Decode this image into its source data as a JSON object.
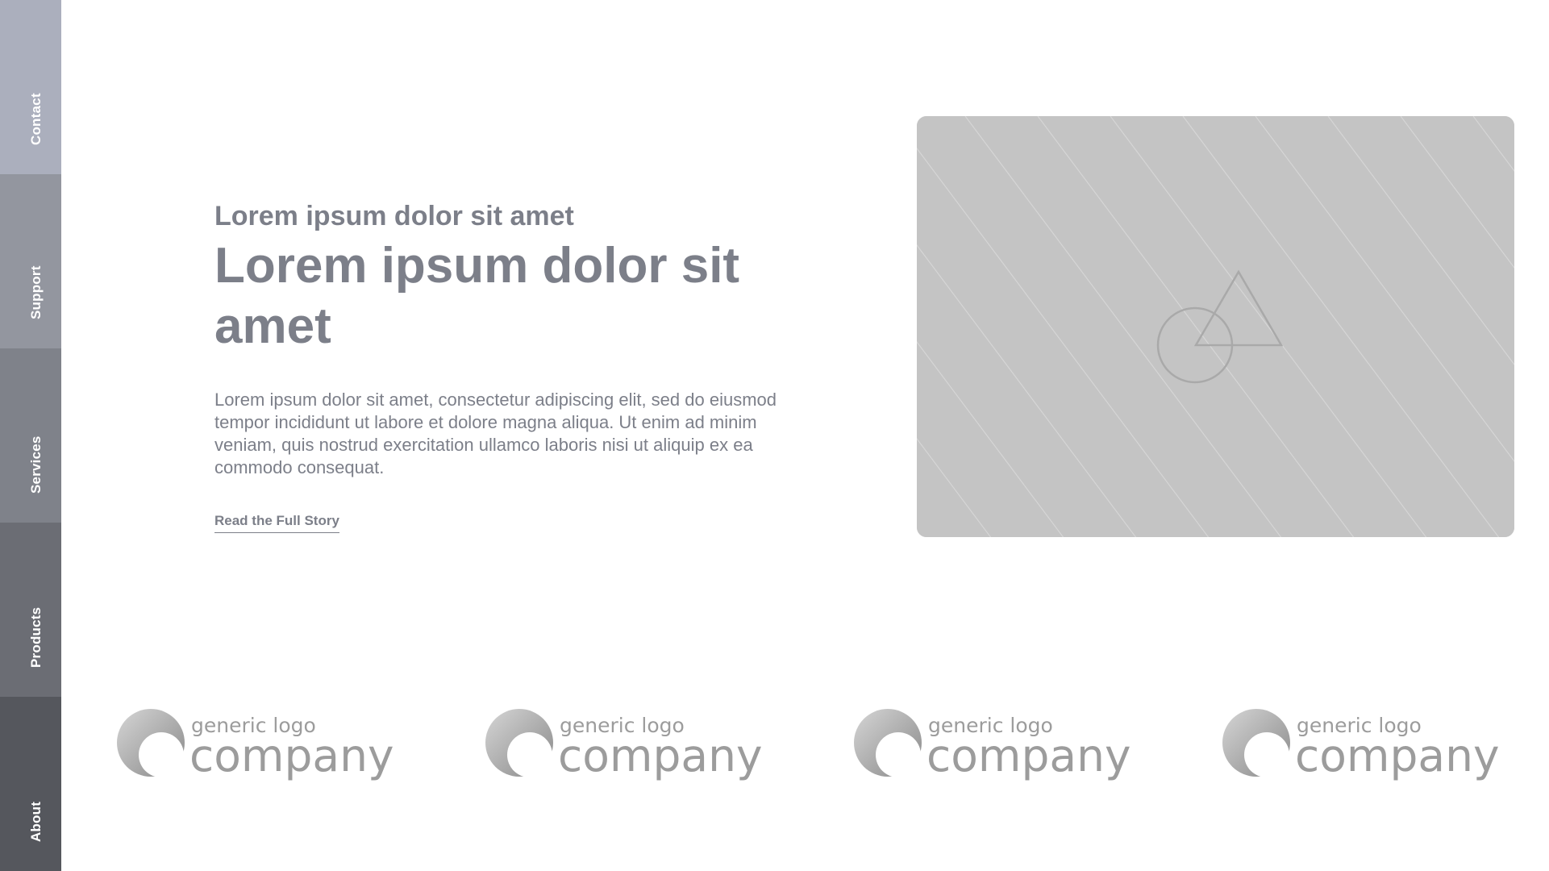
{
  "sidebar": {
    "items": [
      {
        "label": "Contact",
        "color": "#abafbd"
      },
      {
        "label": "Support",
        "color": "#93969f"
      },
      {
        "label": "Services",
        "color": "#7f828a"
      },
      {
        "label": "Products",
        "color": "#6b6d74"
      },
      {
        "label": "About",
        "color": "#55575d"
      }
    ]
  },
  "hero": {
    "subtitle": "Lorem ipsum dolor sit amet",
    "title": "Lorem ipsum dolor sit amet",
    "body": "Lorem ipsum dolor sit amet, consectetur adipiscing elit, sed do eiusmod tempor incididunt ut labore et dolore magna aliqua. Ut enim ad minim veniam, quis nostrud exercitation ullamco laboris nisi ut aliquip ex ea commodo consequat.",
    "link_label": "Read the Full Story"
  },
  "media": {
    "placeholder_icon": "image-placeholder-icon",
    "background_color": "#c4c4c4"
  },
  "logos": [
    {
      "small": "generic logo",
      "big": "company"
    },
    {
      "small": "generic logo",
      "big": "company"
    },
    {
      "small": "generic logo",
      "big": "company"
    },
    {
      "small": "generic logo",
      "big": "company"
    }
  ],
  "colors": {
    "text": "#7c7f89",
    "logo": "#9c9c9c"
  }
}
